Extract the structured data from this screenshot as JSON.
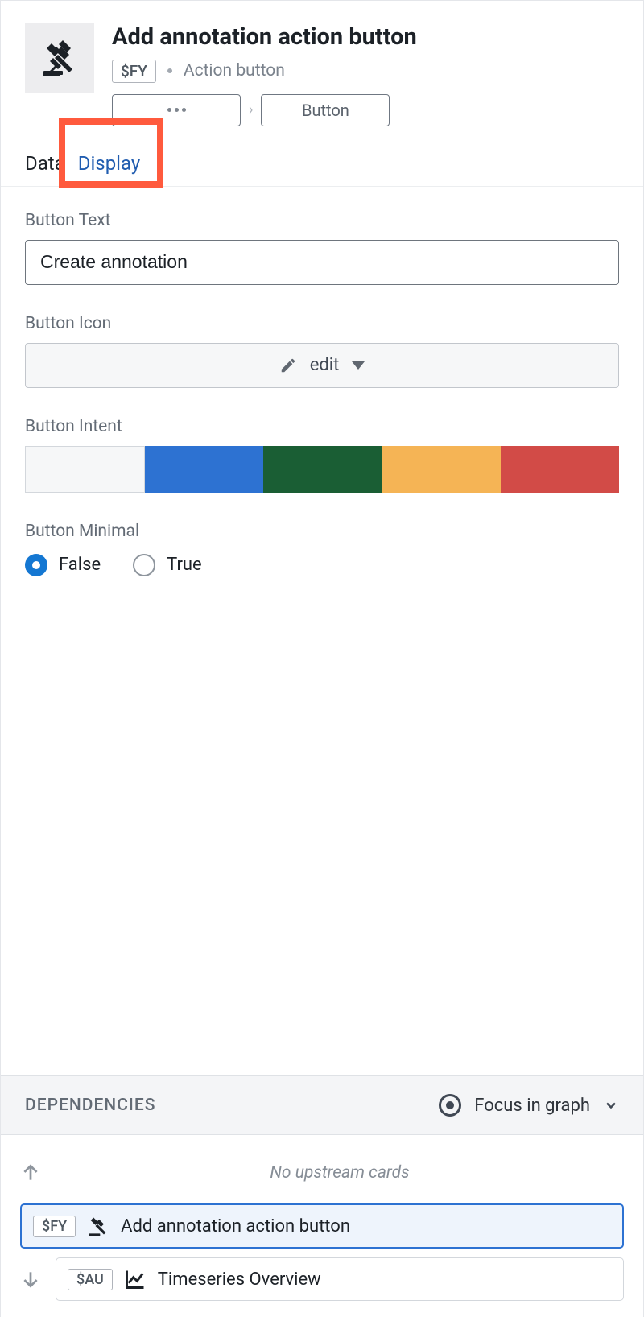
{
  "header": {
    "title": "Add annotation action button",
    "tag": "$FY",
    "type_label": "Action button",
    "breadcrumb_current": "Button"
  },
  "tabs": {
    "data": "Data",
    "display": "Display"
  },
  "fields": {
    "button_text_label": "Button Text",
    "button_text_value": "Create annotation",
    "button_icon_label": "Button Icon",
    "button_icon_value": "edit",
    "button_intent_label": "Button Intent",
    "button_minimal_label": "Button Minimal",
    "radio_false": "False",
    "radio_true": "True"
  },
  "intent_colors": {
    "none": "#f6f7f8",
    "primary": "#2d72d2",
    "success": "#1a5e34",
    "warning": "#f5b455",
    "danger": "#d24b47"
  },
  "dependencies": {
    "title": "DEPENDENCIES",
    "focus_label": "Focus in graph",
    "no_upstream": "No upstream cards",
    "self": {
      "tag": "$FY",
      "label": "Add annotation action button"
    },
    "downstream": {
      "tag": "$AU",
      "label": "Timeseries Overview"
    }
  }
}
